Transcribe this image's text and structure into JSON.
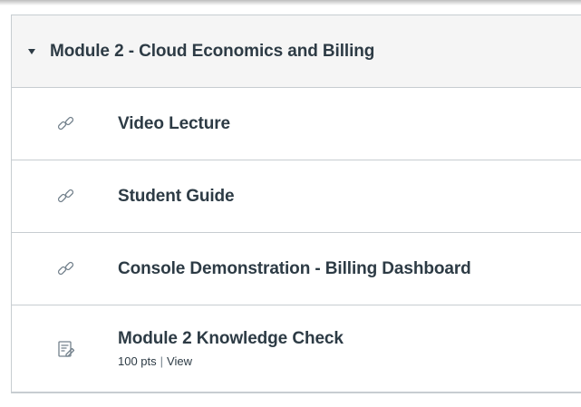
{
  "module": {
    "title": "Module 2 - Cloud Economics and Billing",
    "collapse_icon": "caret-down-icon",
    "items": [
      {
        "icon": "link-icon",
        "title": "Video Lecture"
      },
      {
        "icon": "link-icon",
        "title": "Student Guide"
      },
      {
        "icon": "link-icon",
        "title": "Console Demonstration - Billing Dashboard"
      },
      {
        "icon": "quiz-icon",
        "title": "Module 2 Knowledge Check",
        "points": "100 pts",
        "separator": "|",
        "action": "View"
      }
    ]
  },
  "colors": {
    "text": "#2d3b45",
    "icon": "#73818c",
    "header_bg": "#f5f5f5",
    "border": "#c7cdd1"
  }
}
